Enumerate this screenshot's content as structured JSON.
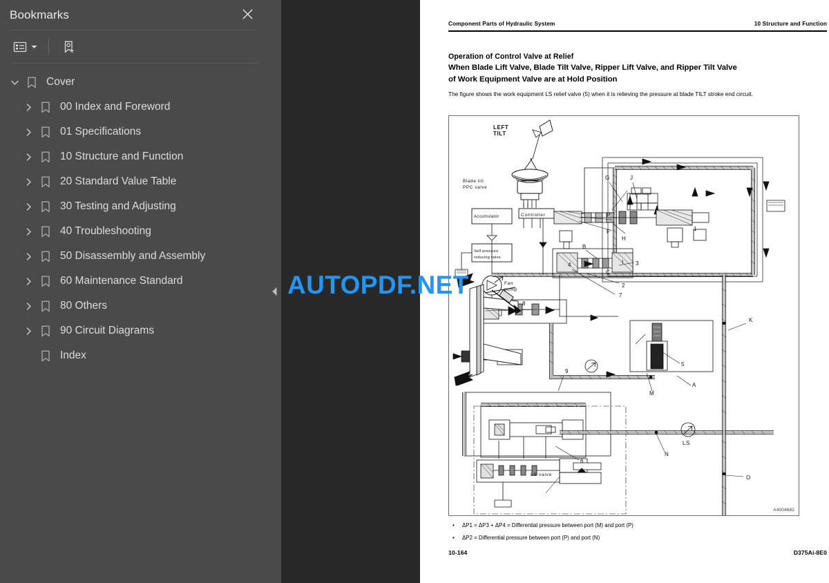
{
  "sidebar": {
    "title": "Bookmarks",
    "close_icon": "close-icon",
    "toolbar": {
      "options_label": "Bookmark options",
      "options_icon": "list-options-icon",
      "caret_icon": "chevron-down-icon",
      "new_bookmark_label": "New bookmark",
      "new_bookmark_icon": "new-bookmark-icon"
    },
    "items": [
      {
        "label": "Cover",
        "level": 0,
        "state": "expanded"
      },
      {
        "label": "00 Index and Foreword",
        "level": 1,
        "state": "collapsed"
      },
      {
        "label": "01 Specifications",
        "level": 1,
        "state": "collapsed"
      },
      {
        "label": "10 Structure and Function",
        "level": 1,
        "state": "collapsed"
      },
      {
        "label": "20 Standard Value Table",
        "level": 1,
        "state": "collapsed"
      },
      {
        "label": "30 Testing and Adjusting",
        "level": 1,
        "state": "collapsed"
      },
      {
        "label": "40 Troubleshooting",
        "level": 1,
        "state": "collapsed"
      },
      {
        "label": "50 Disassembly and Assembly",
        "level": 1,
        "state": "collapsed"
      },
      {
        "label": "60 Maintenance Standard",
        "level": 1,
        "state": "collapsed"
      },
      {
        "label": "80 Others",
        "level": 1,
        "state": "collapsed"
      },
      {
        "label": "90 Circuit Diagrams",
        "level": 1,
        "state": "collapsed"
      },
      {
        "label": "Index",
        "level": 1,
        "state": "leaf"
      }
    ]
  },
  "splitter": {
    "collapse_icon": "chevron-left-icon",
    "tooltip": "Collapse panel"
  },
  "watermark": {
    "text": "AUTOPDF.NET",
    "color": "#2196f3"
  },
  "page": {
    "header": {
      "left": "Component Parts of Hydraulic System",
      "right": "10 Structure and Function"
    },
    "title_line1": "Operation of Control Valve at Relief",
    "title_line2": "When Blade Lift Valve, Blade Tilt Valve, Ripper Lift Valve, and Ripper Tilt Valve",
    "title_line3": "of Work Equipment Valve are at Hold Position",
    "lead": "The figure shows the work equipment LS relief valve (5) when it is relieving the pressure at blade TILT stroke end circuit.",
    "figure": {
      "drawing_number": "A4004682",
      "labels": {
        "left_tilt": "LEFT\nTILT",
        "left_tilt_1": "LEFT",
        "left_tilt_2": "TILT",
        "blade_tilt_ppc_1": "Blade tilt",
        "blade_tilt_ppc_2": "PPC valve",
        "accumulator": "Accumulator",
        "controller": "Controller",
        "self_pressure_1": "Self pressure",
        "self_pressure_2": "reducing valve",
        "fan_pump_1": "Fan",
        "fan_pump_2": "pump",
        "ls_valve": "LS valve",
        "ls": "LS"
      },
      "callouts": [
        "P",
        "F",
        "C",
        "G",
        "J",
        "H",
        "B",
        "I",
        "K",
        "O",
        "N",
        "A",
        "M",
        "1",
        "2",
        "3",
        "4",
        "5",
        "6",
        "7",
        "8",
        "9"
      ]
    },
    "notes": [
      {
        "bullet": "•",
        "text": "ΔP1 = ΔP3 + ΔP4 = Differential pressure between port (M) and port (P)"
      },
      {
        "bullet": "•",
        "text": "ΔP2 = Differential pressure between port (P) and port (N)"
      }
    ],
    "footer": {
      "left": "10-164",
      "right": "D375Ai-8E0"
    }
  },
  "colors": {
    "sidebar_bg": "#4a4a4a",
    "viewer_bg": "#282828",
    "page_bg": "#ffffff",
    "accent": "#2196f3",
    "text": "#dcdcdc"
  }
}
